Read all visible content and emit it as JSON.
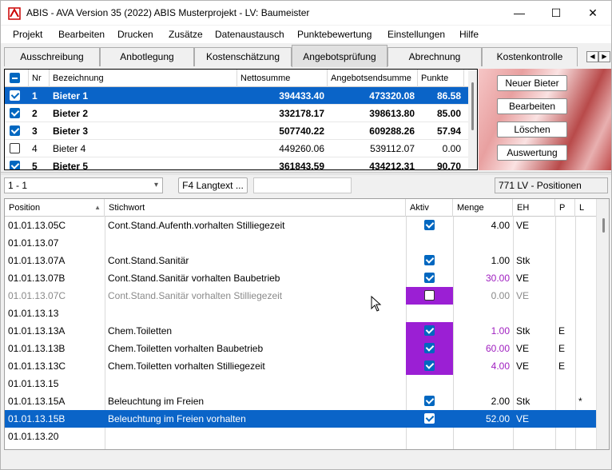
{
  "window": {
    "title": "ABIS - AVA Version 35 (2022) ABIS Musterprojekt - LV: Baumeister",
    "minimize": "—",
    "maximize": "☐",
    "close": "✕"
  },
  "menu": [
    "Projekt",
    "Bearbeiten",
    "Drucken",
    "Zusätze",
    "Datenaustausch",
    "Punktebewertung",
    "Einstellungen",
    "Hilfe"
  ],
  "tabs": [
    "Ausschreibung",
    "Anbotlegung",
    "Kostenschätzung",
    "Angebotsprüfung",
    "Abrechnung",
    "Kostenkontrolle"
  ],
  "active_tab": "Angebotsprüfung",
  "bidders": {
    "columns": [
      "Nr",
      "Bezeichnung",
      "Nettosumme",
      "Angebotsendsumme",
      "Punkte"
    ],
    "rows": [
      {
        "nr": "1",
        "name": "Bieter 1",
        "netto": "394433.40",
        "end": "473320.08",
        "punkte": "86.58",
        "checked": true,
        "bold": true,
        "selected": true
      },
      {
        "nr": "2",
        "name": "Bieter 2",
        "netto": "332178.17",
        "end": "398613.80",
        "punkte": "85.00",
        "checked": true,
        "bold": true,
        "selected": false
      },
      {
        "nr": "3",
        "name": "Bieter 3",
        "netto": "507740.22",
        "end": "609288.26",
        "punkte": "57.94",
        "checked": true,
        "bold": true,
        "selected": false
      },
      {
        "nr": "4",
        "name": "Bieter 4",
        "netto": "449260.06",
        "end": "539112.07",
        "punkte": "0.00",
        "checked": false,
        "bold": false,
        "selected": false
      },
      {
        "nr": "5",
        "name": "Bieter 5",
        "netto": "361843.59",
        "end": "434212.31",
        "punkte": "90.70",
        "checked": true,
        "bold": true,
        "selected": false
      }
    ]
  },
  "buttons": {
    "new": "Neuer Bieter",
    "edit": "Bearbeiten",
    "delete": "Löschen",
    "eval": "Auswertung"
  },
  "toolbar": {
    "combo_value": "1 - 1",
    "langtext": "F4 Langtext ...",
    "count": "771 LV - Positionen"
  },
  "positions": {
    "columns": [
      "Position",
      "Stichwort",
      "Aktiv",
      "Menge",
      "EH",
      "P",
      "L"
    ],
    "rows": [
      {
        "pos": "01.01.13.05C",
        "text": "Cont.Stand.Aufenth.vorhalten Stilliegezeit",
        "aktiv": "on",
        "menge": "4.00",
        "eh": "VE",
        "p": "",
        "l": "",
        "style": ""
      },
      {
        "pos": "01.01.13.07",
        "text": "",
        "aktiv": "",
        "menge": "",
        "eh": "",
        "p": "",
        "l": "",
        "style": ""
      },
      {
        "pos": "01.01.13.07A",
        "text": "Cont.Stand.Sanitär",
        "aktiv": "on",
        "menge": "1.00",
        "eh": "Stk",
        "p": "",
        "l": "",
        "style": ""
      },
      {
        "pos": "01.01.13.07B",
        "text": "Cont.Stand.Sanitär vorhalten Baubetrieb",
        "aktiv": "on",
        "menge": "30.00",
        "eh": "VE",
        "p": "",
        "l": "",
        "style": "magenta"
      },
      {
        "pos": "01.01.13.07C",
        "text": "Cont.Stand.Sanitär vorhalten Stilliegezeit",
        "aktiv": "off",
        "menge": "0.00",
        "eh": "VE",
        "p": "",
        "l": "",
        "style": "grey",
        "purple": true
      },
      {
        "pos": "01.01.13.13",
        "text": "",
        "aktiv": "",
        "menge": "",
        "eh": "",
        "p": "",
        "l": "",
        "style": ""
      },
      {
        "pos": "01.01.13.13A",
        "text": "Chem.Toiletten",
        "aktiv": "on",
        "menge": "1.00",
        "eh": "Stk",
        "p": "E",
        "l": "",
        "style": "magenta",
        "purple": true
      },
      {
        "pos": "01.01.13.13B",
        "text": "Chem.Toiletten vorhalten Baubetrieb",
        "aktiv": "on",
        "menge": "60.00",
        "eh": "VE",
        "p": "E",
        "l": "",
        "style": "magenta",
        "purple": true
      },
      {
        "pos": "01.01.13.13C",
        "text": "Chem.Toiletten vorhalten Stilliegezeit",
        "aktiv": "on",
        "menge": "4.00",
        "eh": "VE",
        "p": "E",
        "l": "",
        "style": "magenta",
        "purple": true
      },
      {
        "pos": "01.01.13.15",
        "text": "",
        "aktiv": "",
        "menge": "",
        "eh": "",
        "p": "",
        "l": "",
        "style": ""
      },
      {
        "pos": "01.01.13.15A",
        "text": "Beleuchtung im Freien",
        "aktiv": "on",
        "menge": "2.00",
        "eh": "Stk",
        "p": "",
        "l": "*",
        "style": ""
      },
      {
        "pos": "01.01.13.15B",
        "text": "Beleuchtung im Freien vorhalten",
        "aktiv": "onw",
        "menge": "52.00",
        "eh": "VE",
        "p": "",
        "l": "",
        "style": "sel"
      },
      {
        "pos": "01.01.13.20",
        "text": "",
        "aktiv": "",
        "menge": "",
        "eh": "",
        "p": "",
        "l": "",
        "style": ""
      }
    ]
  }
}
